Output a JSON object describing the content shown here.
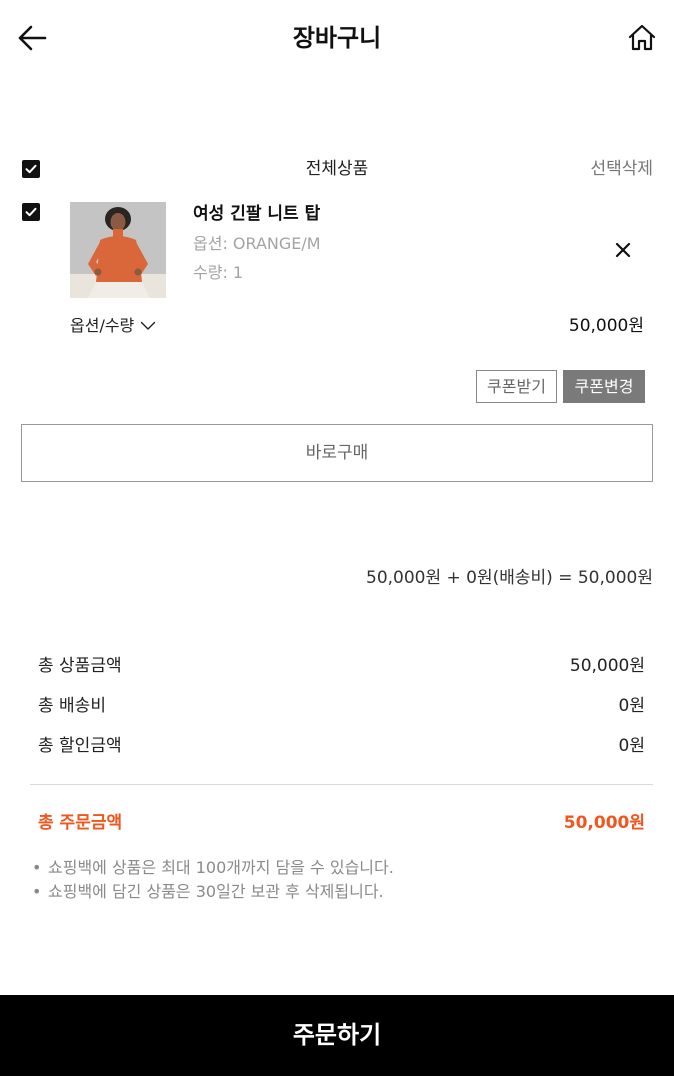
{
  "header": {
    "title": "장바구니",
    "back_icon": "arrow-left-icon",
    "home_icon": "home-icon"
  },
  "cart": {
    "select_all_checked": true,
    "select_all_label": "전체상품",
    "delete_selected_label": "선택삭제"
  },
  "item": {
    "checked": true,
    "name": "여성 긴팔 니트 탑",
    "option": "옵션: ORANGE/M",
    "quantity": "수량: 1",
    "option_qty_label": "옵션/수량",
    "price": "50,000원",
    "remove_icon": "close-icon",
    "coupon_get_label": "쿠폰받기",
    "coupon_change_label": "쿠폰변경",
    "buy_now_label": "바로구매"
  },
  "summary": {
    "formula": "50,000원 + 0원(배송비) = 50,000원",
    "rows": [
      {
        "label": "총 상품금액",
        "value": "50,000원"
      },
      {
        "label": "총 배송비",
        "value": "0원"
      },
      {
        "label": "총 할인금액",
        "value": "0원"
      }
    ],
    "total_label": "총 주문금액",
    "total_value": "50,000원"
  },
  "notices": [
    "쇼핑백에 상품은 최대 100개까지 담을 수 있습니다.",
    "쇼핑백에 담긴 상품은 30일간 보관 후 삭제됩니다."
  ],
  "footer": {
    "order_label": "주문하기"
  },
  "colors": {
    "accent": "#f0561e",
    "order_button": "#000000",
    "coupon_change_bg": "#7a7a7a"
  }
}
